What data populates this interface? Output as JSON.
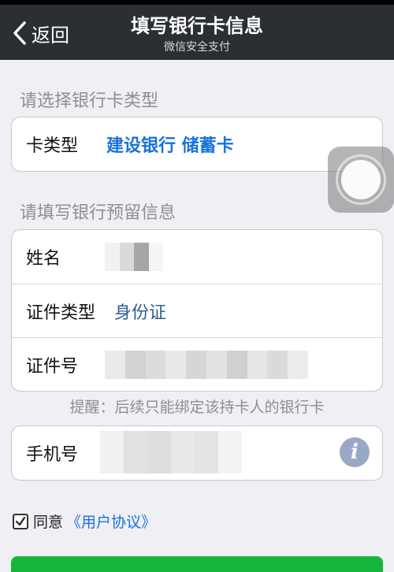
{
  "nav": {
    "back_label": "返回",
    "title": "填写银行卡信息",
    "subtitle": "微信安全支付"
  },
  "card_type_section": {
    "title": "请选择银行卡类型",
    "label": "卡类型",
    "value": "建设银行 储蓄卡"
  },
  "reserved_info_section": {
    "title": "请填写银行预留信息",
    "name_label": "姓名",
    "id_type_label": "证件类型",
    "id_type_value": "身份证",
    "id_number_label": "证件号"
  },
  "reminder": "提醒：后续只能绑定该持卡人的银行卡",
  "phone": {
    "label": "手机号",
    "info_icon": "i"
  },
  "agreement": {
    "agree_label": "同意",
    "link_label": "《用户协议》"
  },
  "colors": {
    "nav_bg": "#2b2f34",
    "link_blue": "#1a73d9",
    "primary_green": "#15b53c",
    "page_bg": "#efeff4"
  },
  "icons": [
    "chevron-left-icon",
    "info-icon",
    "checkmark-icon",
    "assistive-touch-icon"
  ]
}
